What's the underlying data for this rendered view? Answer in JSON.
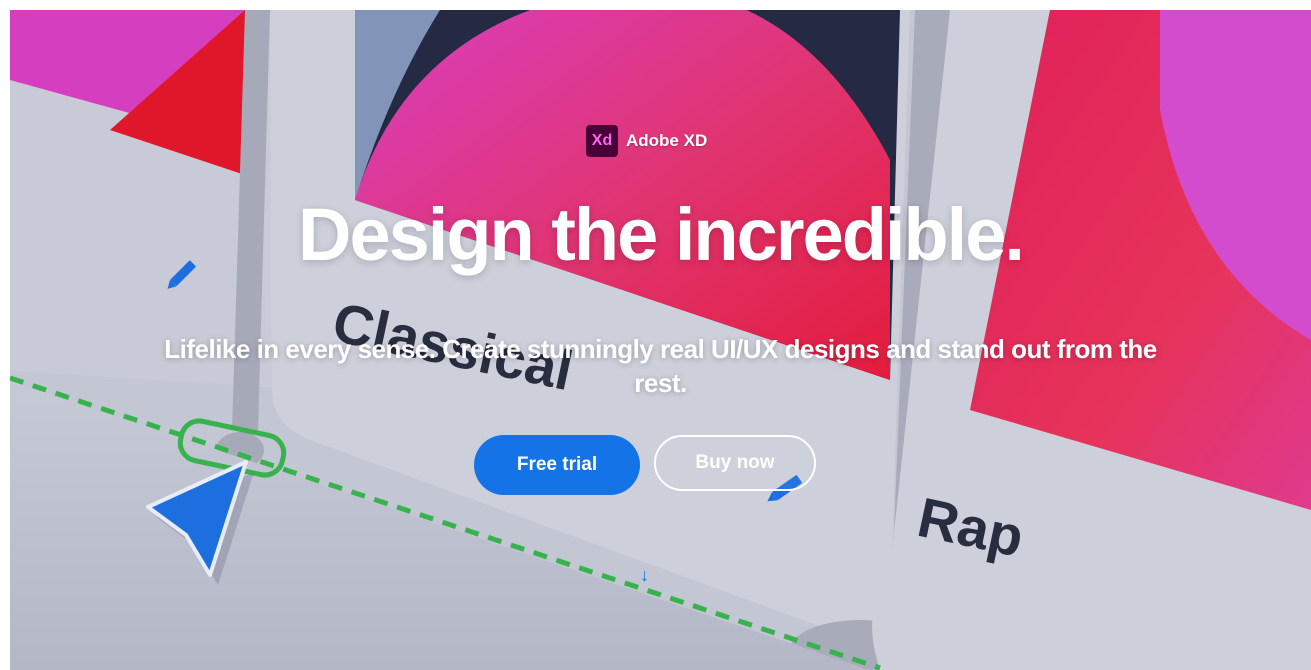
{
  "brand": {
    "logo_text": "Xd",
    "name": "Adobe XD"
  },
  "hero": {
    "headline": "Design the incredible.",
    "subheadline": "Lifelike in every sense. Create stunningly real UI/UX designs and stand out from the rest.",
    "card_labels": [
      "Classical",
      "Rap"
    ]
  },
  "cta": {
    "primary_label": "Free trial",
    "secondary_label": "Buy now"
  },
  "icons": {
    "scroll": "arrow-down-icon",
    "pencil": "pencil-icon",
    "cursor": "cursor-pointer-icon"
  },
  "colors": {
    "accent_blue": "#1473e6",
    "magenta": "#d845c8",
    "red": "#e21e3d",
    "navy": "#272c45",
    "card_grey": "#cdd0db",
    "selection_green": "#3bb54a",
    "xd_logo_bg": "#470137",
    "xd_logo_text": "#ff61f6"
  }
}
